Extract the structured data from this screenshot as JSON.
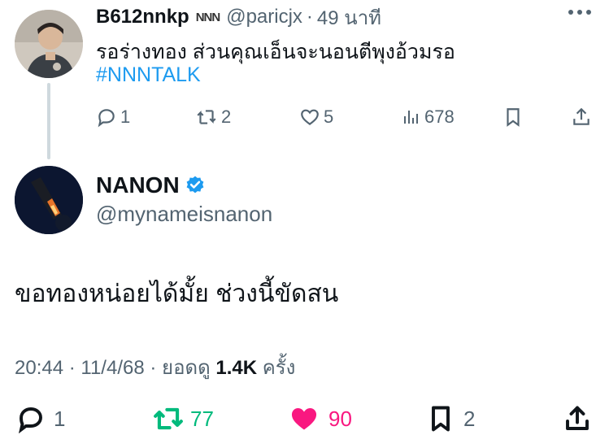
{
  "original_post": {
    "display_name": "B612nnkp",
    "name_badge": "NNN",
    "handle": "@paricjx",
    "separator": "·",
    "time": "49 นาที",
    "text": "รอร่างทอง ส่วนคุณเอ็นจะนอนตีพุงอ้วมรอ",
    "hashtag": "#NNNTALK",
    "replies": "1",
    "reposts": "2",
    "likes": "5",
    "views": "678"
  },
  "reply_post": {
    "display_name": "NANON",
    "handle": "@mynameisnanon",
    "text": "ขอทองหน่อยได้มั้ย ช่วงนี้ขัดสน",
    "timestamp": "20:44 · 11/4/68",
    "views_prefix": "· ยอดดู",
    "views_count": "1.4K",
    "views_suffix": "ครั้ง",
    "replies": "1",
    "reposts": "77",
    "likes": "90",
    "bookmarks": "2"
  },
  "colors": {
    "link": "#1d9bf0",
    "secondary_text": "#536471",
    "repost_active": "#00ba7c",
    "like_active": "#f91880",
    "verified": "#1d9bf0"
  },
  "icons": [
    "more-icon",
    "reply-icon",
    "repost-icon",
    "like-icon",
    "views-icon",
    "bookmark-icon",
    "share-icon",
    "verified-badge-icon"
  ]
}
